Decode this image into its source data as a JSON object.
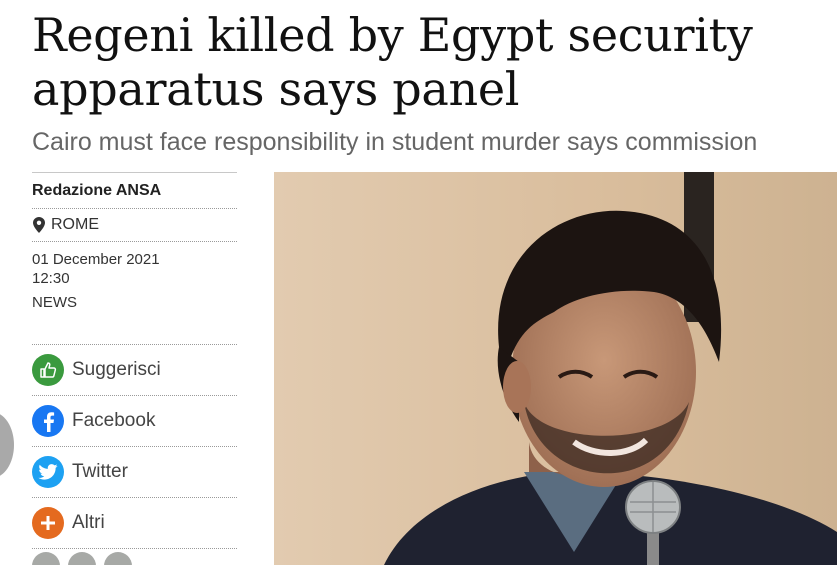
{
  "article": {
    "headline_line1": "Regeni killed by Egypt security",
    "headline_line2": "apparatus says panel",
    "subheadline": "Cairo must face responsibility in student murder says commission"
  },
  "meta": {
    "author": "Redazione ANSA",
    "location": "ROME",
    "date": "01 December 2021",
    "time": "12:30",
    "category": "NEWS"
  },
  "share": {
    "items": [
      {
        "label": "Suggerisci",
        "icon": "thumbs-up-icon",
        "color": "#3a9a3e"
      },
      {
        "label": "Facebook",
        "icon": "facebook-icon",
        "color": "#1877f2"
      },
      {
        "label": "Twitter",
        "icon": "twitter-icon",
        "color": "#1da1f2"
      },
      {
        "label": "Altri",
        "icon": "plus-icon",
        "color": "#e46a1f"
      }
    ]
  },
  "photo": {
    "icon": "portrait-photo"
  }
}
